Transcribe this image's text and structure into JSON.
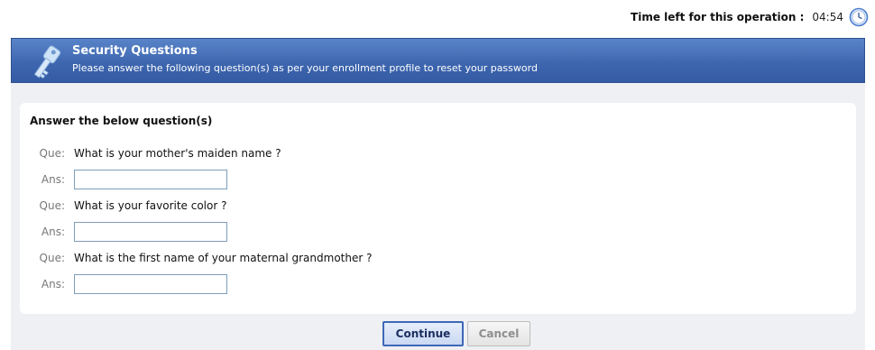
{
  "timer": {
    "label": "Time left for this operation :",
    "value": "04:54",
    "icon": "clock-icon"
  },
  "banner": {
    "icon": "key-icon",
    "title": "Security Questions",
    "subtitle": "Please answer the following question(s) as per your enrollment profile to reset your password"
  },
  "form": {
    "heading": "Answer the below question(s)",
    "question_prefix": "Que:",
    "answer_prefix": "Ans:",
    "questions": [
      {
        "text": "What is your mother's maiden name ?",
        "answer": ""
      },
      {
        "text": "What is your favorite color ?",
        "answer": ""
      },
      {
        "text": "What is the first name of your maternal grandmother ?",
        "answer": ""
      }
    ]
  },
  "buttons": {
    "continue_label": "Continue",
    "cancel_label": "Cancel"
  },
  "colors": {
    "banner": "#3e67b0",
    "panel_background": "#eef0f3",
    "continue_border": "#3e68b8"
  }
}
